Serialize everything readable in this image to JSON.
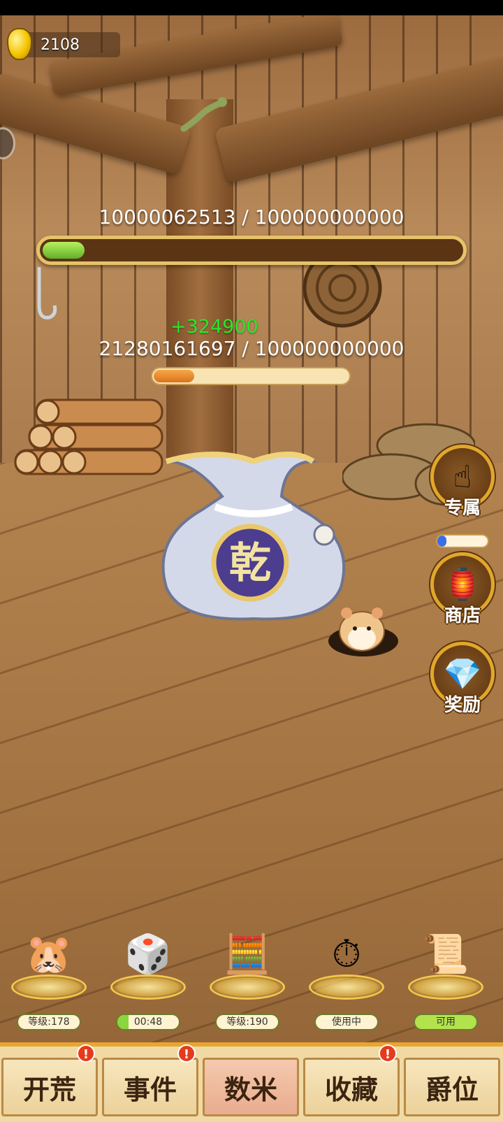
{
  "currency": {
    "icon": "gold-ingot-icon",
    "value": "2108"
  },
  "progress_main": {
    "label": "10000062513 / 100000000000",
    "fraction": 0.1
  },
  "progress_sub": {
    "label": "21280161697 / 100000000000",
    "fraction": 0.21,
    "gain": "+324900"
  },
  "bag": {
    "emblem": "乾"
  },
  "side_buttons": [
    {
      "label": "专属",
      "icon": "hand-icon",
      "progress": 0.18
    },
    {
      "label": "商店",
      "icon": "shop-icon"
    },
    {
      "label": "奖励",
      "icon": "treasure-chest-icon"
    }
  ],
  "tools": [
    {
      "icon": "hamster-icon",
      "badge": "等级:178"
    },
    {
      "icon": "dice-icon",
      "badge": "00:48",
      "timer_fraction": 0.18
    },
    {
      "icon": "abacus-icon",
      "badge": "等级:190"
    },
    {
      "icon": "pocket-watch-icon",
      "badge": "使用中"
    },
    {
      "icon": "scroll-icon",
      "badge": "可用"
    }
  ],
  "nav": [
    {
      "label": "开荒",
      "alert": "!"
    },
    {
      "label": "事件",
      "alert": "!"
    },
    {
      "label": "数米",
      "active": true
    },
    {
      "label": "收藏",
      "alert": "!"
    },
    {
      "label": "爵位"
    }
  ],
  "colors": {
    "accent": "#e8a630",
    "alert": "#e53b1c",
    "gain": "#29e52a"
  }
}
